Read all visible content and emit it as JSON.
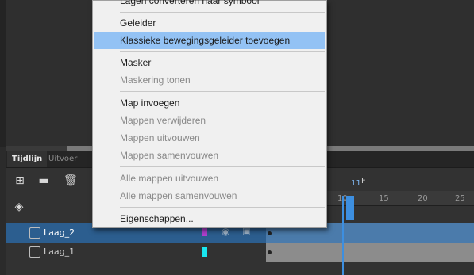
{
  "context_menu": {
    "items": [
      {
        "label": "Lagen converteren naar symbool",
        "enabled": true,
        "highlighted": false
      },
      {
        "label": "Geleider",
        "enabled": true,
        "highlighted": false
      },
      {
        "label": "Klassieke bewegingsgeleider toevoegen",
        "enabled": true,
        "highlighted": true
      },
      {
        "label": "Masker",
        "enabled": true,
        "highlighted": false
      },
      {
        "label": "Maskering tonen",
        "enabled": false,
        "highlighted": false
      },
      {
        "label": "Map invoegen",
        "enabled": true,
        "highlighted": false
      },
      {
        "label": "Mappen verwijderen",
        "enabled": false,
        "highlighted": false
      },
      {
        "label": "Mappen uitvouwen",
        "enabled": false,
        "highlighted": false
      },
      {
        "label": "Mappen samenvouwen",
        "enabled": false,
        "highlighted": false
      },
      {
        "label": "Alle mappen uitvouwen",
        "enabled": false,
        "highlighted": false
      },
      {
        "label": "Alle mappen samenvouwen",
        "enabled": false,
        "highlighted": false
      },
      {
        "label": "Eigenschappen...",
        "enabled": true,
        "highlighted": false
      }
    ]
  },
  "timeline": {
    "tabs": [
      {
        "label": "Tijdlijn",
        "active": true
      },
      {
        "label": "Uitvoer",
        "active": false
      }
    ],
    "current_frame": "11",
    "frame_marker": "F",
    "ruler_ticks": [
      "10",
      "15",
      "20",
      "25"
    ],
    "layers": [
      {
        "name": "Laag_2",
        "selected": true,
        "color": "#b040d0"
      },
      {
        "name": "Laag_1",
        "selected": false,
        "color": "#19e6f0"
      }
    ]
  }
}
